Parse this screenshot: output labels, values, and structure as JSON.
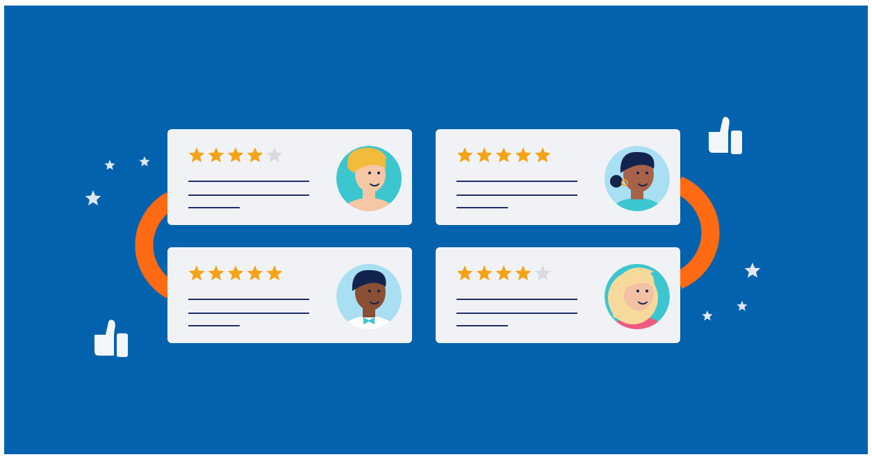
{
  "colors": {
    "background": "#0362ad",
    "card": "#f1f2f6",
    "connector": "#ff6a13",
    "star_filled": "#f5a316",
    "star_empty": "#d9d9de",
    "text_line": "#1f2c6b",
    "decor_star": "#dfe7f2",
    "thumb": "#f4f5f8"
  },
  "reviews": [
    {
      "rating": 4,
      "max": 5,
      "avatar": "man-blond-winking",
      "avatar_bg": "#3cc6cf"
    },
    {
      "rating": 5,
      "max": 5,
      "avatar": "woman-dark-hair-bun",
      "avatar_bg": "#a9dff2"
    },
    {
      "rating": 5,
      "max": 5,
      "avatar": "man-dark-curly-hair",
      "avatar_bg": "#a9dff2"
    },
    {
      "rating": 4,
      "max": 5,
      "avatar": "woman-blonde-wavy",
      "avatar_bg": "#3cc6cf"
    }
  ],
  "decorations": {
    "icons": [
      "thumbs-up-icon",
      "star-icon",
      "connector-loop"
    ]
  }
}
